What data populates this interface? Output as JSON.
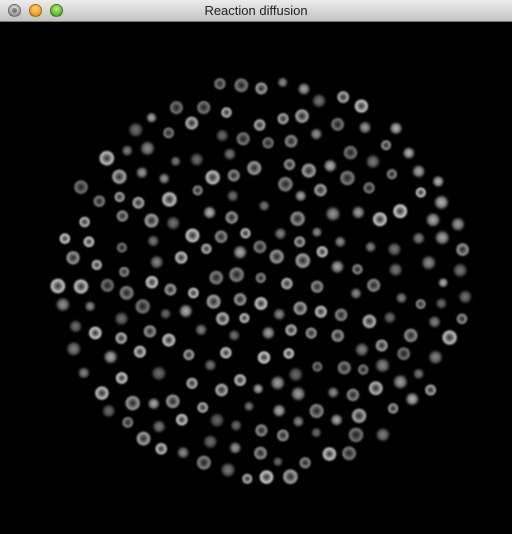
{
  "window": {
    "title": "Reaction diffusion",
    "controls": [
      {
        "name": "close-button",
        "color": "#9a9a9a"
      },
      {
        "name": "minimize-button",
        "color": "#f0a018"
      },
      {
        "name": "zoom-button",
        "color": "#5fb62a"
      }
    ]
  },
  "simulation": {
    "background": "#000000",
    "spot_color": "#d8d8d8"
  }
}
